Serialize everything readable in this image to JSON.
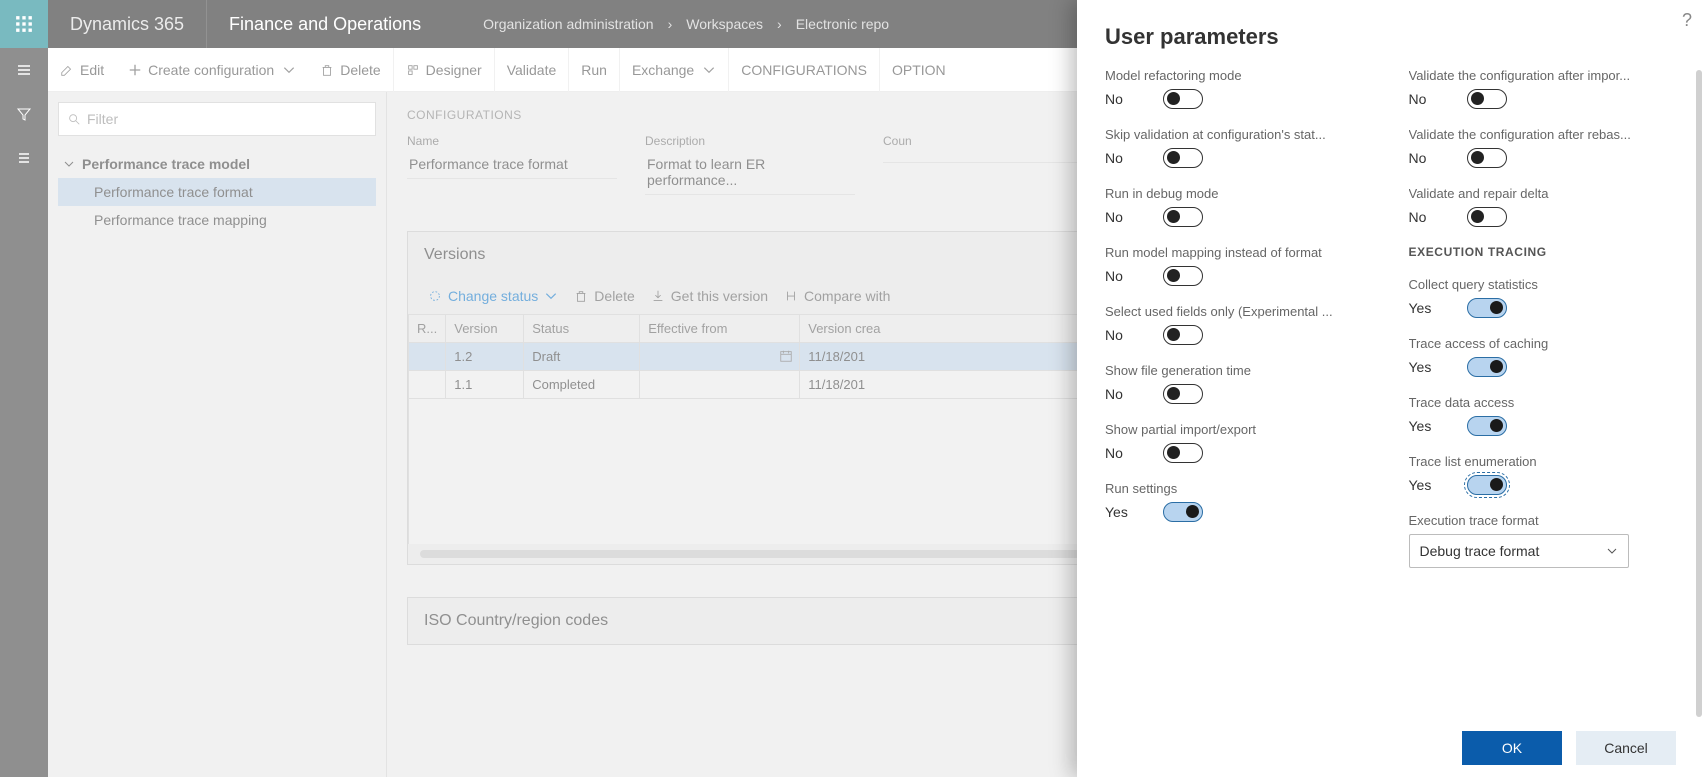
{
  "topbar": {
    "brand": "Dynamics 365",
    "app": "Finance and Operations"
  },
  "breadcrumb": {
    "a": "Organization administration",
    "b": "Workspaces",
    "c": "Electronic repo"
  },
  "cmd": {
    "edit": "Edit",
    "create": "Create configuration",
    "delete": "Delete",
    "designer": "Designer",
    "validate": "Validate",
    "run": "Run",
    "exchange": "Exchange",
    "configs": "CONFIGURATIONS",
    "options": "OPTION"
  },
  "filter_placeholder": "Filter",
  "tree": {
    "root": "Performance trace model",
    "items": [
      "Performance trace format",
      "Performance trace mapping"
    ],
    "selected": 0
  },
  "form": {
    "section": "CONFIGURATIONS",
    "name_label": "Name",
    "name_value": "Performance trace format",
    "desc_label": "Description",
    "desc_value": "Format to learn ER performance...",
    "country_label": "Coun"
  },
  "versions": {
    "title": "Versions",
    "tools": {
      "change": "Change status",
      "delete": "Delete",
      "get": "Get this version",
      "compare": "Compare with"
    },
    "columns": [
      "R...",
      "Version",
      "Status",
      "Effective from",
      "Version crea"
    ],
    "rows": [
      {
        "r": "",
        "version": "1.2",
        "status": "Draft",
        "eff": "",
        "created": "11/18/201"
      },
      {
        "r": "",
        "version": "1.1",
        "status": "Completed",
        "eff": "",
        "created": "11/18/201"
      }
    ],
    "selected_row": 0
  },
  "iso": {
    "title": "ISO Country/region codes"
  },
  "panel": {
    "title": "User parameters",
    "left": [
      {
        "label": "Model refactoring mode",
        "val": "No",
        "on": false
      },
      {
        "label": "Skip validation at configuration's stat...",
        "val": "No",
        "on": false
      },
      {
        "label": "Run in debug mode",
        "val": "No",
        "on": false
      },
      {
        "label": "Run model mapping instead of format",
        "val": "No",
        "on": false
      },
      {
        "label": "Select used fields only (Experimental ...",
        "val": "No",
        "on": false
      },
      {
        "label": "Show file generation time",
        "val": "No",
        "on": false
      },
      {
        "label": "Show partial import/export",
        "val": "No",
        "on": false
      },
      {
        "label": "Run settings",
        "val": "Yes",
        "on": true
      }
    ],
    "right_top": [
      {
        "label": "Validate the configuration after impor...",
        "val": "No",
        "on": false
      },
      {
        "label": "Validate the configuration after rebas...",
        "val": "No",
        "on": false
      },
      {
        "label": "Validate and repair delta",
        "val": "No",
        "on": false
      }
    ],
    "exec_head": "EXECUTION TRACING",
    "exec": [
      {
        "label": "Collect query statistics",
        "val": "Yes",
        "on": true
      },
      {
        "label": "Trace access of caching",
        "val": "Yes",
        "on": true
      },
      {
        "label": "Trace data access",
        "val": "Yes",
        "on": true
      },
      {
        "label": "Trace list enumeration",
        "val": "Yes",
        "on": true,
        "focus": true
      }
    ],
    "select_label": "Execution trace format",
    "select_value": "Debug trace format",
    "ok": "OK",
    "cancel": "Cancel"
  }
}
